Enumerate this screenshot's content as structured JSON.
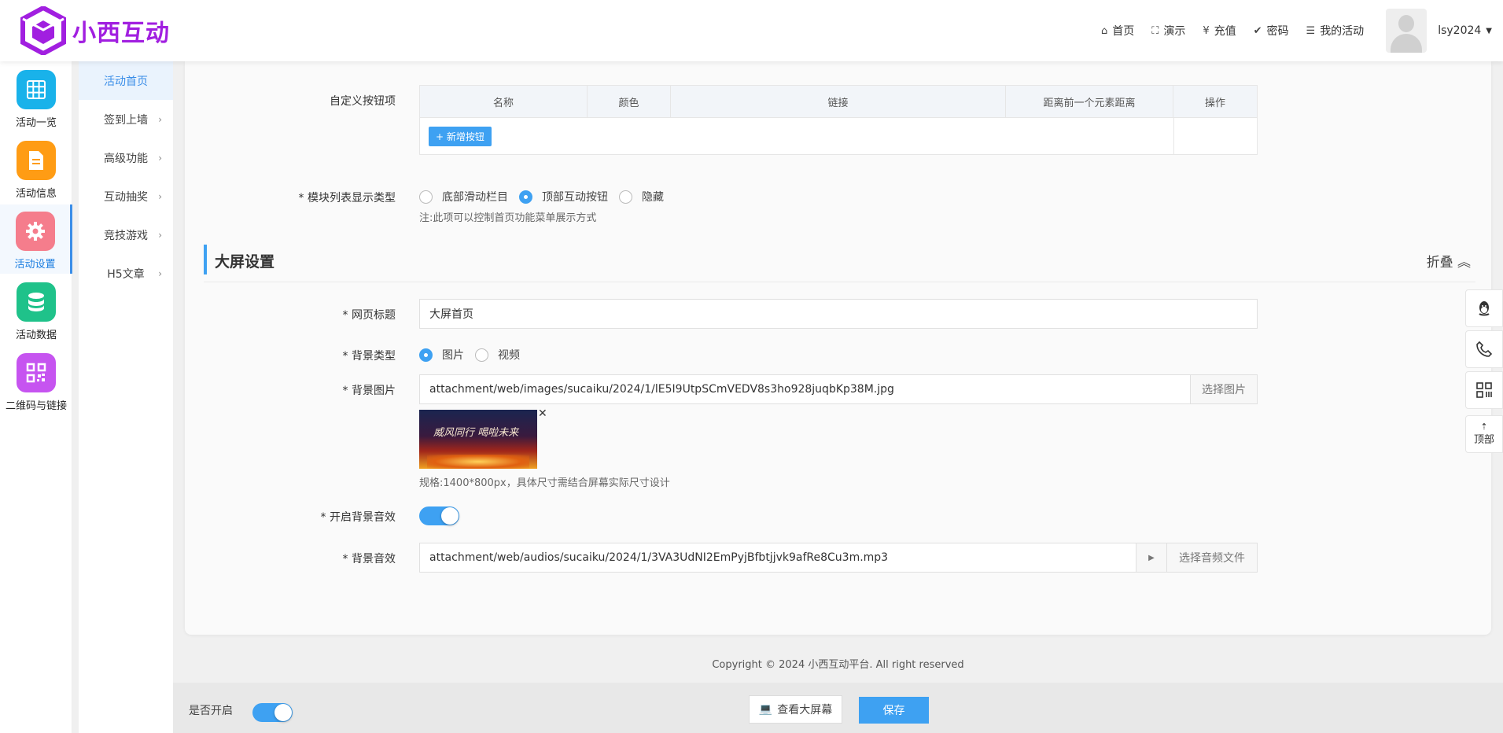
{
  "brand": {
    "name": "小西互动",
    "color": "#a11fe0"
  },
  "topnav": {
    "items": [
      {
        "icon": "home-icon",
        "label": "首页"
      },
      {
        "icon": "fullscreen-icon",
        "label": "演示"
      },
      {
        "icon": "yen-icon",
        "label": "充值"
      },
      {
        "icon": "check-circle-icon",
        "label": "密码"
      },
      {
        "icon": "list-icon",
        "label": "我的活动"
      }
    ],
    "username": "lsy2024"
  },
  "sidebar": {
    "items": [
      {
        "label": "活动一览",
        "color": "#19b2ea",
        "icon": "grid-icon"
      },
      {
        "label": "活动信息",
        "color": "#ff9c14",
        "icon": "document-icon"
      },
      {
        "label": "活动设置",
        "color": "#f57d8c",
        "icon": "gear-icon",
        "active": true
      },
      {
        "label": "活动数据",
        "color": "#1fc28a",
        "icon": "database-icon"
      },
      {
        "label": "二维码与链接",
        "color": "#c654f0",
        "icon": "qrcode-icon"
      }
    ]
  },
  "subnav": {
    "items": [
      {
        "label": "活动首页",
        "active": true
      },
      {
        "label": "签到上墙"
      },
      {
        "label": "高级功能"
      },
      {
        "label": "互动抽奖"
      },
      {
        "label": "竞技游戏"
      },
      {
        "label": "H5文章"
      }
    ]
  },
  "custom_buttons": {
    "label": "自定义按钮项",
    "columns": [
      "名称",
      "颜色",
      "链接",
      "距离前一个元素距离",
      "操作"
    ],
    "add_label": "+ 新增按钮"
  },
  "module_display": {
    "label": "* 模块列表显示类型",
    "options": [
      "底部滑动栏目",
      "顶部互动按钮",
      "隐藏"
    ],
    "selected": "顶部互动按钮",
    "hint": "注:此项可以控制首页功能菜单展示方式"
  },
  "bigscreen": {
    "title": "大屏设置",
    "fold_label": "折叠",
    "page_title_label": "* 网页标题",
    "page_title_value": "大屏首页",
    "bg_type_label": "* 背景类型",
    "bg_type_options": [
      "图片",
      "视频"
    ],
    "bg_type_selected": "图片",
    "bg_image_label": "* 背景图片",
    "bg_image_value": "attachment/web/images/sucaiku/2024/1/lE5I9UtpSCmVEDV8s3ho928juqbKp38M.jpg",
    "bg_image_button": "选择图片",
    "thumb_text": "威风同行 喝啦未来",
    "spec_hint": "规格:1400*800px，具体尺寸需结合屏幕实际尺寸设计",
    "bg_sound_switch_label": "* 开启背景音效",
    "bg_sound_on": true,
    "bg_sound_label": "* 背景音效",
    "bg_sound_value": "attachment/web/audios/sucaiku/2024/1/3VA3UdNI2EmPyjBfbtjjvk9afRe8Cu3m.mp3",
    "bg_sound_button": "选择音频文件"
  },
  "footer": {
    "copyright": "Copyright © 2024 小西互动平台. All right reserved"
  },
  "bottombar": {
    "enabled_label": "是否开启",
    "enabled": true,
    "view_label": "查看大屏幕",
    "save_label": "保存"
  },
  "float_tools": {
    "top_label": "顶部",
    "top_arrow": "⇡"
  }
}
